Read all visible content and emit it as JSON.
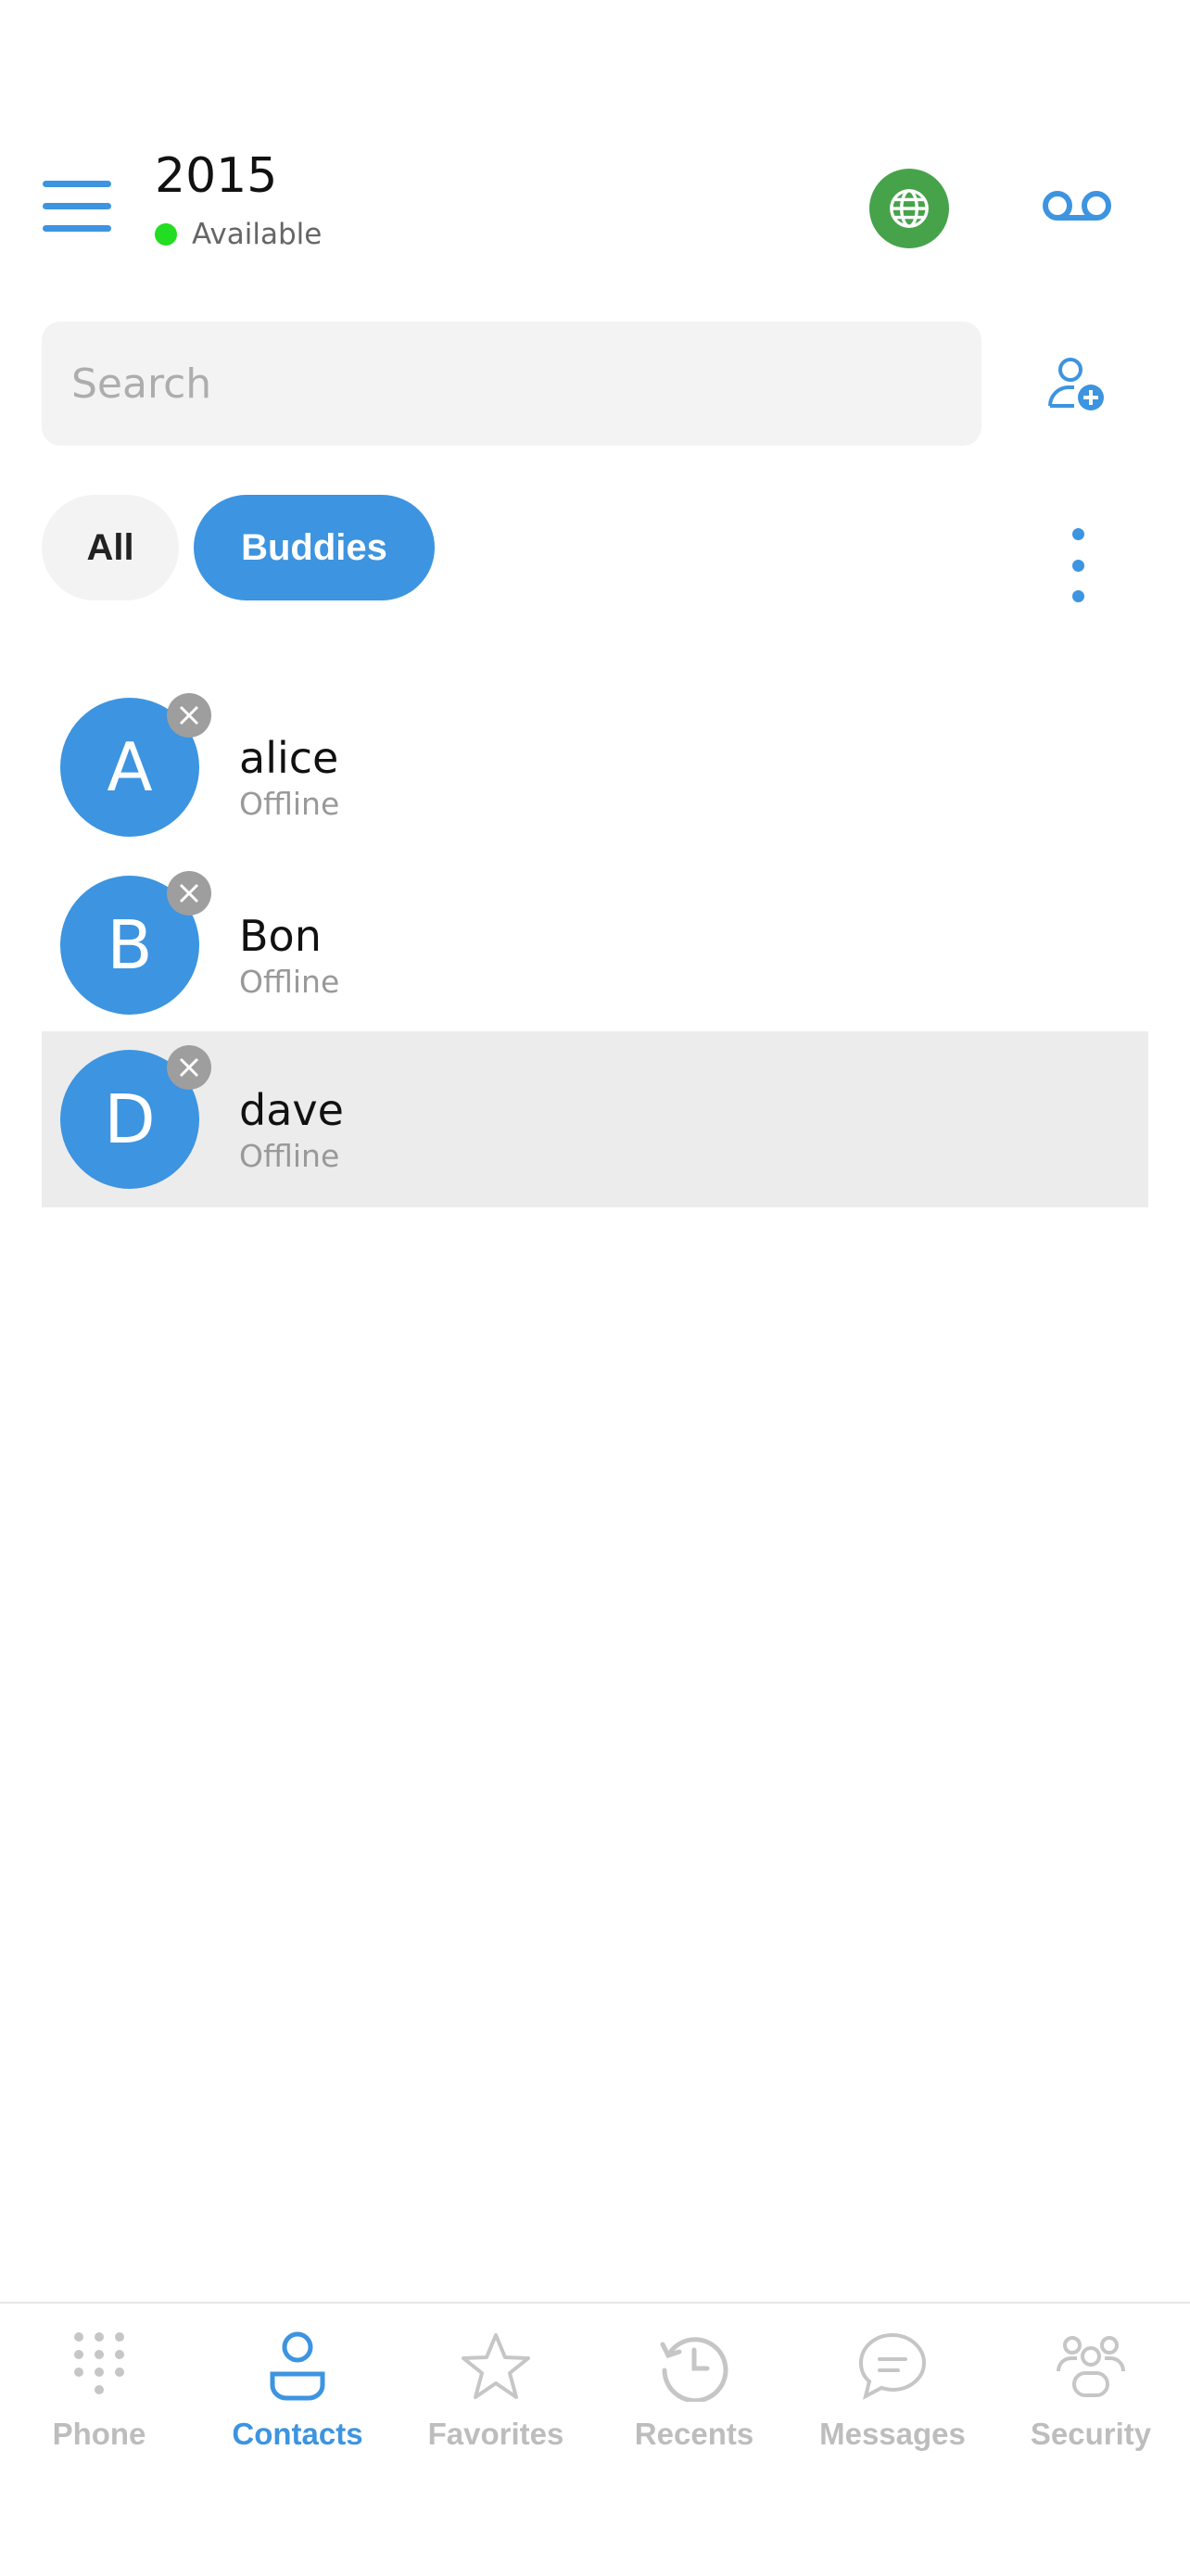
{
  "header": {
    "title": "2015",
    "status": "Available",
    "status_color": "#22dd22",
    "menu_icon": "hamburger-icon",
    "globe_icon": "globe-icon",
    "voicemail_icon": "voicemail-icon"
  },
  "search": {
    "placeholder": "Search",
    "value": ""
  },
  "add_contact_icon": "add-contact-icon",
  "filters": {
    "all_label": "All",
    "buddies_label": "Buddies",
    "active": "Buddies"
  },
  "contacts": [
    {
      "initial": "A",
      "name": "alice",
      "status": "Offline"
    },
    {
      "initial": "B",
      "name": "Bon",
      "status": "Offline"
    },
    {
      "initial": "D",
      "name": "dave",
      "status": "Offline"
    }
  ],
  "nav": {
    "items": [
      {
        "label": "Phone",
        "icon": "dialpad-icon"
      },
      {
        "label": "Contacts",
        "icon": "contacts-icon"
      },
      {
        "label": "Favorites",
        "icon": "star-icon"
      },
      {
        "label": "Recents",
        "icon": "history-icon"
      },
      {
        "label": "Messages",
        "icon": "chat-icon"
      },
      {
        "label": "Security",
        "icon": "security-group-icon"
      }
    ],
    "active": "Contacts"
  },
  "colors": {
    "accent": "#3d94e0",
    "globe": "#47a34a",
    "inactive": "#bdbdbd"
  }
}
